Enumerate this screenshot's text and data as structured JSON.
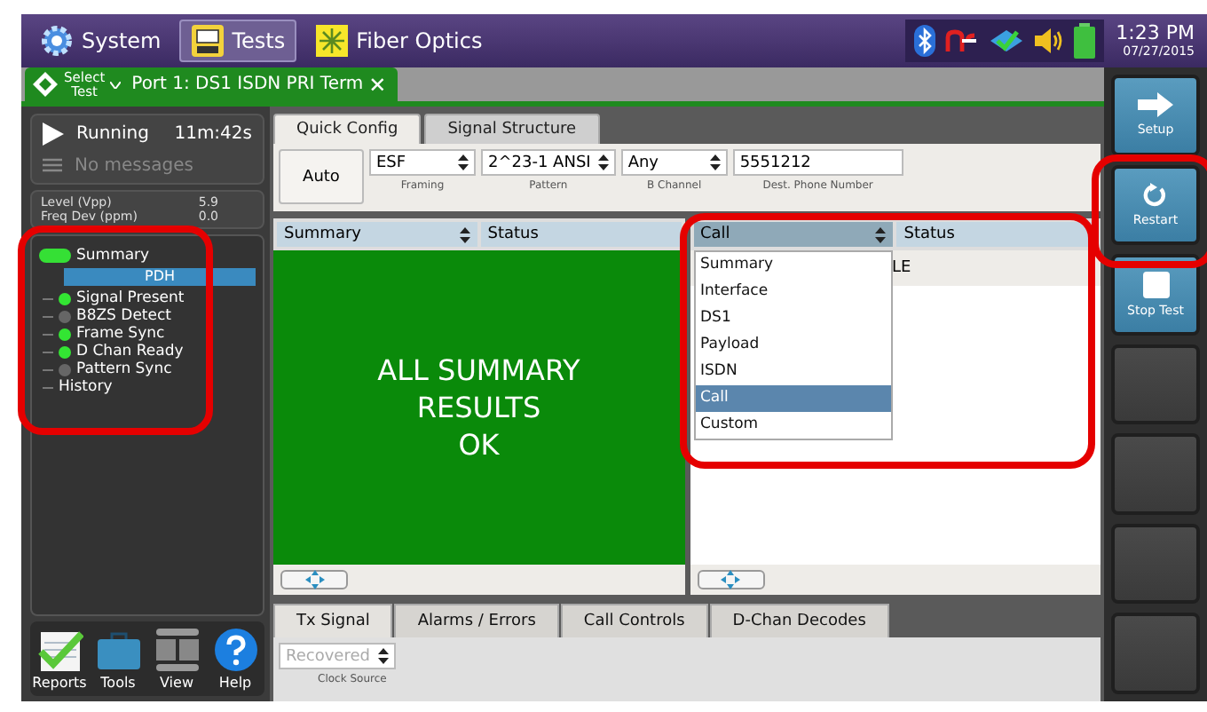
{
  "top_bar": {
    "tabs": [
      {
        "label": "System",
        "kind": "gear",
        "selected": false
      },
      {
        "label": "Tests",
        "kind": "bert",
        "selected": true
      },
      {
        "label": "Fiber Optics",
        "kind": "fiber",
        "selected": false
      }
    ],
    "time": "1:23 PM",
    "date": "07/27/2015"
  },
  "test_tab": {
    "select_lines": [
      "Select",
      "Test"
    ],
    "title": "Port 1: DS1 ISDN PRI Term",
    "close": "✕"
  },
  "status": {
    "state": "Running",
    "elapsed": "11m:42s",
    "messages": "No messages",
    "readings": [
      {
        "label": "Level (Vpp)",
        "value": "5.9"
      },
      {
        "label": "Freq Dev (ppm)",
        "value": "0.0"
      }
    ]
  },
  "tree": {
    "summary": "Summary",
    "section": "PDH",
    "items": [
      {
        "label": "Signal Present",
        "kind": "led",
        "on": true
      },
      {
        "label": "B8ZS Detect",
        "kind": "led",
        "on": false
      },
      {
        "label": "Frame Sync",
        "kind": "led",
        "on": true
      },
      {
        "label": "D Chan Ready",
        "kind": "led",
        "on": true
      },
      {
        "label": "Pattern Sync",
        "kind": "led",
        "on": false
      },
      {
        "label": "History",
        "kind": "plain"
      }
    ]
  },
  "bottom_icons": [
    {
      "label": "Reports",
      "kind": "reports"
    },
    {
      "label": "Tools",
      "kind": "tools"
    },
    {
      "label": "View",
      "kind": "view"
    },
    {
      "label": "Help",
      "kind": "help"
    }
  ],
  "config_tabs": [
    {
      "label": "Quick Config",
      "selected": true
    },
    {
      "label": "Signal Structure",
      "selected": false
    }
  ],
  "auto_button": "Auto",
  "fields": [
    {
      "kind": "select",
      "value": "ESF",
      "label": "Framing"
    },
    {
      "kind": "select",
      "value": "2^23-1 ANSI",
      "label": "Pattern"
    },
    {
      "kind": "select",
      "value": "Any",
      "label": "B Channel"
    },
    {
      "kind": "text",
      "value": "5551212",
      "label": "Dest. Phone Number"
    }
  ],
  "left_result": {
    "columns": [
      "Summary",
      "Status"
    ],
    "message_lines": [
      "ALL SUMMARY",
      "RESULTS",
      "OK"
    ]
  },
  "right_result": {
    "columns": [
      "Call",
      "Status"
    ],
    "cell": "LE",
    "dropdown": [
      {
        "label": "Summary",
        "selected": false
      },
      {
        "label": "Interface",
        "selected": false
      },
      {
        "label": "DS1",
        "selected": false
      },
      {
        "label": "Payload",
        "selected": false
      },
      {
        "label": "ISDN",
        "selected": false
      },
      {
        "label": "Call",
        "selected": true
      },
      {
        "label": "Custom",
        "selected": false
      }
    ]
  },
  "bottom_tabs": [
    {
      "label": "Tx Signal",
      "selected": true
    },
    {
      "label": "Alarms / Errors",
      "selected": false
    },
    {
      "label": "Call Controls",
      "selected": false
    },
    {
      "label": "D-Chan Decodes",
      "selected": false
    }
  ],
  "clock_source": {
    "value": "Recovered",
    "label": "Clock Source",
    "disabled": true
  },
  "side_buttons": [
    {
      "label": "Setup",
      "kind": "arrow"
    },
    {
      "label": "Restart",
      "kind": "restart"
    },
    {
      "label": "Stop Test",
      "kind": "stop"
    },
    {
      "kind": "empty"
    },
    {
      "kind": "empty"
    },
    {
      "kind": "empty"
    },
    {
      "kind": "empty"
    }
  ]
}
